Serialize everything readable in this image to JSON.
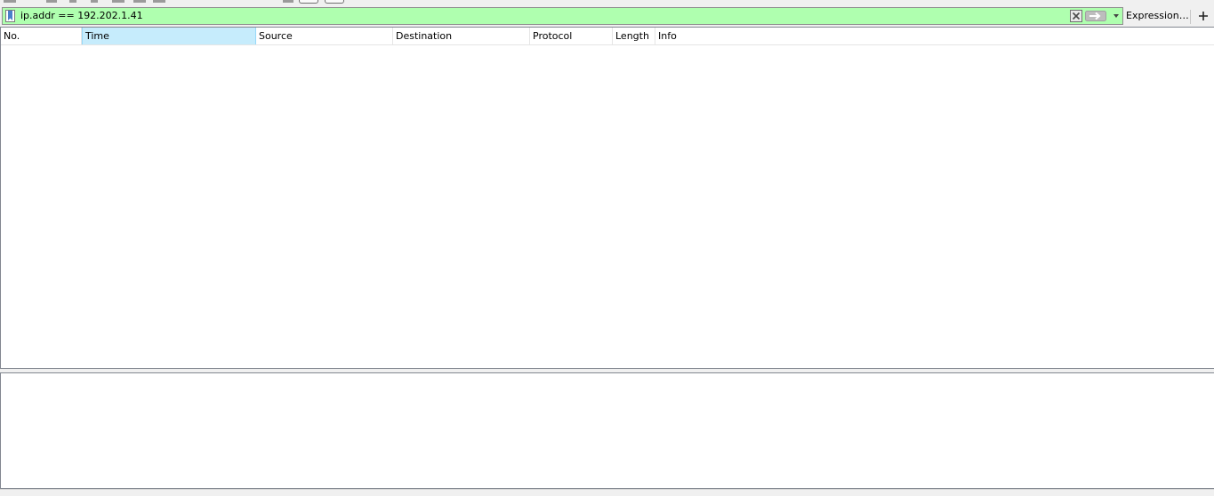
{
  "filter": {
    "value": "ip.addr == 192.202.1.41",
    "expression_label": "Expression…",
    "highlight_color": "#afffaf"
  },
  "packet_list": {
    "columns": [
      "No.",
      "Time",
      "Source",
      "Destination",
      "Protocol",
      "Length",
      "Info"
    ],
    "sorted_column": "Time",
    "rows": []
  },
  "icons": {
    "bookmark": "bookmark-icon",
    "clear": "clear-icon",
    "apply": "arrow-right-icon",
    "dropdown": "chevron-down-icon",
    "add": "plus-icon"
  }
}
